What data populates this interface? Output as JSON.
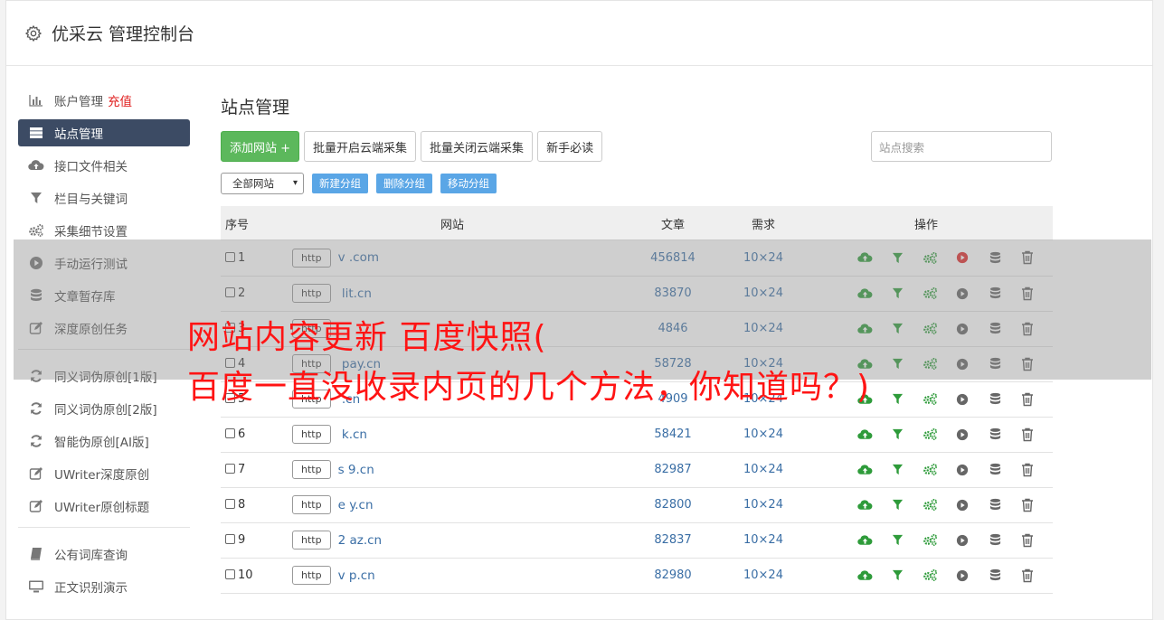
{
  "app": {
    "title": "优采云 管理控制台",
    "icon": "gear-icon"
  },
  "sidebar": {
    "items": [
      {
        "label": "账户管理",
        "badge": "充值",
        "icon": "bar-chart-icon"
      },
      {
        "label": "站点管理",
        "icon": "server-icon",
        "active": true
      },
      {
        "label": "接口文件相关",
        "icon": "cloud-upload-icon"
      },
      {
        "label": "栏目与关键词",
        "icon": "filter-icon"
      },
      {
        "label": "采集细节设置",
        "icon": "gears-icon"
      },
      {
        "label": "手动运行测试",
        "icon": "play-circle-icon"
      },
      {
        "label": "文章暂存库",
        "icon": "database-icon"
      },
      {
        "label": "深度原创任务",
        "icon": "edit-icon"
      }
    ],
    "group2": [
      {
        "label": "同义词伪原创[1版]",
        "icon": "refresh-icon"
      },
      {
        "label": "同义词伪原创[2版]",
        "icon": "refresh-icon"
      },
      {
        "label": "智能伪原创[AI版]",
        "icon": "refresh-icon"
      },
      {
        "label": "UWriter深度原创",
        "icon": "edit-icon"
      },
      {
        "label": "UWriter原创标题",
        "icon": "edit-icon"
      }
    ],
    "group3": [
      {
        "label": "公有词库查询",
        "icon": "book-icon"
      },
      {
        "label": "正文识别演示",
        "icon": "monitor-icon"
      }
    ]
  },
  "main": {
    "title": "站点管理",
    "buttons": {
      "add_site": "添加网站 +",
      "batch_open": "批量开启云端采集",
      "batch_close": "批量关闭云端采集",
      "newbie": "新手必读"
    },
    "search_placeholder": "站点搜索",
    "group_select": "全部网站",
    "group_buttons": {
      "new": "新建分组",
      "delete": "删除分组",
      "move": "移动分组"
    },
    "table": {
      "headers": {
        "id": "序号",
        "site": "网站",
        "articles": "文章",
        "demand": "需求",
        "ops": "操作"
      },
      "rows": [
        {
          "id": "1",
          "protocol": "http",
          "domain": "v          .com",
          "articles": "456814",
          "demand": "10×24",
          "play_active": true
        },
        {
          "id": "2",
          "protocol": "http",
          "domain": "      lit.cn",
          "articles": "83870",
          "demand": "10×24"
        },
        {
          "id": "3",
          "protocol": "http",
          "domain": "",
          "articles": "4846",
          "demand": "10×24"
        },
        {
          "id": "4",
          "protocol": "http",
          "domain": "        pay.cn",
          "articles": "58728",
          "demand": "10×24"
        },
        {
          "id": "5",
          "protocol": "http",
          "domain": "        .cn",
          "articles": "4909",
          "demand": "10×24"
        },
        {
          "id": "6",
          "protocol": "http",
          "domain": "      k.cn",
          "articles": "58421",
          "demand": "10×24"
        },
        {
          "id": "7",
          "protocol": "http",
          "domain": "s    9.cn",
          "articles": "82987",
          "demand": "10×24"
        },
        {
          "id": "8",
          "protocol": "http",
          "domain": "e     y.cn",
          "articles": "82800",
          "demand": "10×24"
        },
        {
          "id": "9",
          "protocol": "http",
          "domain": "2     az.cn",
          "articles": "82837",
          "demand": "10×24"
        },
        {
          "id": "10",
          "protocol": "http",
          "domain": "v     p.cn",
          "articles": "82980",
          "demand": "10×24"
        }
      ]
    }
  },
  "overlay_caption": {
    "line1": "网站内容更新 百度快照(",
    "line2": "百度一直没收录内页的几个方法，你知道吗？)"
  },
  "colors": {
    "accent_dark": "#3c4b64",
    "green": "#5cb85c",
    "blue_btn": "#5aa6e6",
    "link": "#3a6ea5",
    "caption": "#ff1414"
  }
}
